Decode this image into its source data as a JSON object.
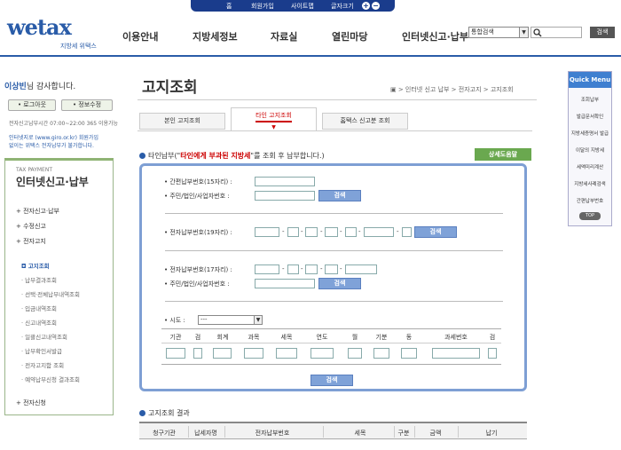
{
  "topbar": {
    "links": [
      "홈",
      "회원가입",
      "사이트맵",
      "글자크기"
    ]
  },
  "logo": {
    "text": "wetax",
    "sub": "지방세 위택스"
  },
  "gnb": [
    "이용안내",
    "지방세정보",
    "자료실",
    "열린마당",
    "인터넷신고·납부"
  ],
  "header_search": {
    "select": "통합검색",
    "button": "검색"
  },
  "login": {
    "user": "이상빈",
    "welcome": "님 감사합니다.",
    "logout": "로그아웃",
    "info": "정보수정",
    "hours": "전자신고납부시간 07:00~22:00 365 이용가능",
    "giro1": "인터넷지로 (www.giro.or.kr) 회원가입",
    "giro2": "없이는 위택스 전자납부가 불가합니다."
  },
  "leftmenu": {
    "eyebrow": "TAX PAYMENT",
    "title": "인터넷신고·납부",
    "items": [
      "+ 전자신고·납부",
      "+ 수정신고",
      "+ 전자고지"
    ],
    "sub": [
      "고지조회",
      "납부결과조회",
      "선택·전체납부내역조회",
      "입금내역조회",
      "신고내역조회",
      "일괄신고내역조회",
      "납부확인서발급",
      "전자고지함 조회",
      "예약납부신청 결과조회"
    ],
    "last": "+ 전자신청"
  },
  "page": {
    "title": "고지조회",
    "breadcrumb": "▣ > 인터넷 신고 납부 > 전자고지 > 고지조회"
  },
  "tabs": [
    "본인 고지조회",
    "타인 고지조회",
    "홈택스 신고분 조회"
  ],
  "section": {
    "prefix": "타인납부(\"",
    "red": "타인에게 부과된 지방세",
    "suffix": "\"를 조회 후 납부합니다.)",
    "help": "상세도움말"
  },
  "form": {
    "l1": "간편납부번호(15자리) :",
    "l2": "주민/법인/사업자번호 :",
    "l3": "전자납부번호(19자리) :",
    "l4": "전자납부번호(17자리) :",
    "l5": "주민/법인/사업자번호 :",
    "sido_label": "시도 :",
    "sido_value": "---",
    "search": "검색",
    "cols": [
      "기관",
      "검",
      "회계",
      "과목",
      "세목",
      "연도",
      "월",
      "기분",
      "동",
      "과세번호",
      "검"
    ]
  },
  "result": {
    "title": "고지조회 결과",
    "cols": [
      "청구기관",
      "납세자명",
      "전자납부번호",
      "세목",
      "구분",
      "금액",
      "납기"
    ]
  },
  "quick": {
    "title": "Quick Menu",
    "items": [
      "조회납부",
      "발급문서확인",
      "지방세증명서 발급",
      "이달의 지방세",
      "세액미리계산",
      "지방세사례검색",
      "간편납부번호"
    ],
    "top": "TOP"
  }
}
